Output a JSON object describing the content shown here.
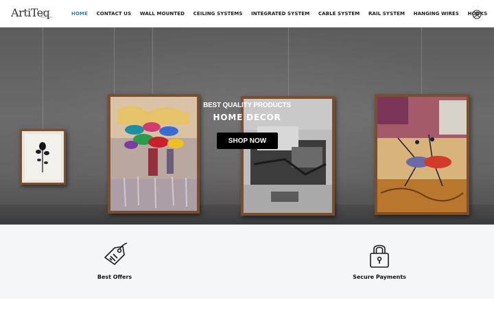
{
  "header": {
    "logo": {
      "wordmark": "ArtiTeq",
      "tagline": "CLEVER HANGING SOLUTIONS"
    },
    "nav": [
      {
        "label": "HOME",
        "active": true
      },
      {
        "label": "CONTACT US",
        "active": false
      },
      {
        "label": "WALL MOUNTED",
        "active": false
      },
      {
        "label": "CEILING SYSTEMS",
        "active": false
      },
      {
        "label": "INTEGRATED SYSTEM",
        "active": false
      },
      {
        "label": "CABLE SYSTEM",
        "active": false
      },
      {
        "label": "RAIL SYSTEM",
        "active": false
      },
      {
        "label": "HANGING WIRES",
        "active": false
      },
      {
        "label": "HOOKS",
        "active": false
      }
    ],
    "account_icon": "user-circle-icon",
    "active_color": "#2a84c5"
  },
  "hero": {
    "subtitle": "BEST QUALITY PRODUCTS",
    "title": "HOME DECOR",
    "cta_label": "SHOP NOW",
    "cta_color": "#000000"
  },
  "features": [
    {
      "label": "Best Offers",
      "icon": "price-tag-icon"
    },
    {
      "label": "Secure Payments",
      "icon": "padlock-icon"
    }
  ]
}
